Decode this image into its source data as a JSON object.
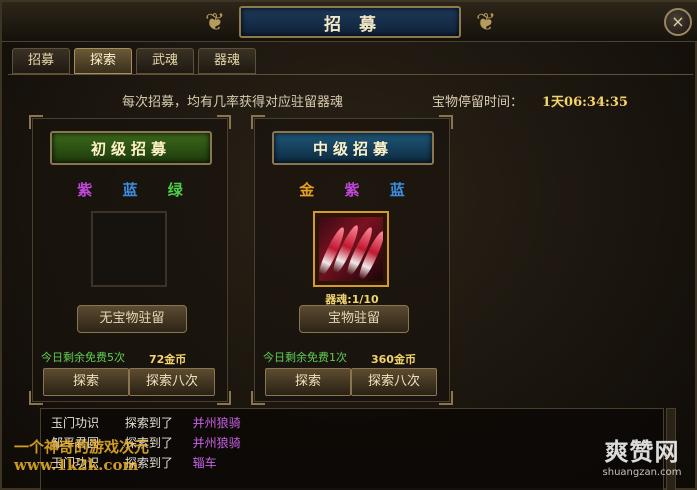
{
  "window": {
    "title": "招募",
    "close_label": "×"
  },
  "tabs": [
    {
      "label": "招募",
      "active": false
    },
    {
      "label": "探索",
      "active": true
    },
    {
      "label": "武魂",
      "active": false
    },
    {
      "label": "器魂",
      "active": false
    }
  ],
  "info": {
    "description": "每次招募，均有几率获得对应驻留器魂",
    "retain_label": "宝物停留时间：",
    "retain_time": "1天06:34:35"
  },
  "panels": [
    {
      "header": "初级招募",
      "grades": [
        "紫",
        "蓝",
        "绿"
      ],
      "grade_colors": [
        "#c048d8",
        "#3a8ee0",
        "#4ed04a"
      ],
      "treasure_progress": "",
      "status_label": "无宝物驻留",
      "free_label": "今日剩余免费5次",
      "cost": "72金币",
      "explore_label": "探索",
      "explore8_label": "探索八次"
    },
    {
      "header": "中级招募",
      "grades": [
        "金",
        "紫",
        "蓝"
      ],
      "grade_colors": [
        "#e8a020",
        "#c048d8",
        "#3a8ee0"
      ],
      "treasure_progress": "器魂:1/10",
      "status_label": "宝物驻留",
      "free_label": "今日剩余免费1次",
      "cost": "360金币",
      "explore_label": "探索",
      "explore8_label": "探索八次"
    }
  ],
  "log": [
    {
      "name": "玉门功识",
      "action": "探索到了",
      "item": "并州狼骑"
    },
    {
      "name": "邹平君圆",
      "action": "探索到了",
      "item": "并州狼骑"
    },
    {
      "name": "玉门功识",
      "action": "探索到了",
      "item": "辎车"
    }
  ],
  "watermarks": {
    "left_line1": "一个神奇的游戏次元",
    "left_line2": "www.1k2k.com",
    "right_big": "爽赞网",
    "right_small": "shuangzan.com"
  }
}
